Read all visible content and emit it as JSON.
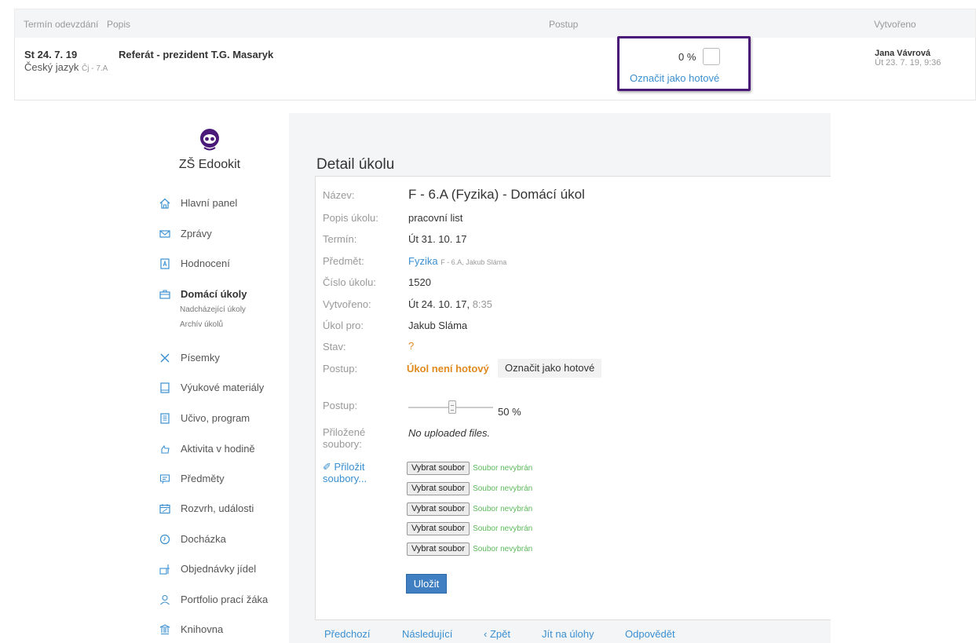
{
  "top_table": {
    "headers": {
      "due": "Termín odevzdání",
      "desc": "Popis",
      "progress": "Postup",
      "created": "Vytvořeno"
    },
    "row": {
      "date": "St 24. 7. 19",
      "subject": "Český jazyk",
      "class": "Čj - 7.A",
      "title": "Referát - prezident T.G. Masaryk",
      "progress_pct": "0 %",
      "mark_done": "Označit jako hotové",
      "author": "Jana Vávrová",
      "created": "Út 23. 7. 19, 9:36"
    }
  },
  "sidebar": {
    "school": "ZŠ Edookit",
    "items": [
      {
        "label": "Hlavní panel",
        "icon": "home-icon"
      },
      {
        "label": "Zprávy",
        "icon": "envelope-icon"
      },
      {
        "label": "Hodnocení",
        "icon": "grade-icon"
      },
      {
        "label": "Domácí úkoly",
        "icon": "briefcase-icon"
      },
      {
        "label": "Písemky",
        "icon": "pencil-ruler-icon"
      },
      {
        "label": "Výukové materiály",
        "icon": "book-icon"
      },
      {
        "label": "Učivo, program",
        "icon": "document-icon"
      },
      {
        "label": "Aktivita v hodině",
        "icon": "hand-icon"
      },
      {
        "label": "Předměty",
        "icon": "subjects-icon"
      },
      {
        "label": "Rozvrh, události",
        "icon": "calendar-icon"
      },
      {
        "label": "Docházka",
        "icon": "clock-icon"
      },
      {
        "label": "Objednávky jídel",
        "icon": "food-icon"
      },
      {
        "label": "Portfolio prací žáka",
        "icon": "person-icon"
      },
      {
        "label": "Knihovna",
        "icon": "library-icon"
      }
    ],
    "subitems": [
      "Nadcházející úkoly",
      "Archív úkolů"
    ]
  },
  "detail": {
    "heading": "Detail úkolu",
    "labels": {
      "name": "Název:",
      "description": "Popis úkolu:",
      "deadline": "Termín:",
      "subject": "Předmět:",
      "number": "Číslo úkolu:",
      "created": "Vytvořeno:",
      "for": "Úkol pro:",
      "state": "Stav:",
      "progress": "Postup:",
      "progress2": "Postup:",
      "attached_1": "Přiložené",
      "attached_2": "soubory:"
    },
    "values": {
      "name": "F - 6.A (Fyzika) - Domácí úkol",
      "description": "pracovní list",
      "deadline": "Út 31. 10. 17",
      "subject": "Fyzika",
      "subject_meta": "F - 6.A, Jakub Sláma",
      "number": "1520",
      "created_date": "Út 24. 10. 17,",
      "created_time": "8:35",
      "for": "Jakub Sláma",
      "state": "?",
      "not_done": "Úkol není hotový",
      "mark_done": "Označit jako hotové",
      "slider_value": "50 %",
      "slider_fraction": 0.5,
      "no_files": "No uploaded files."
    },
    "attach_link_1": "Přiložit",
    "attach_link_2": "soubory...",
    "file_button": "Vybrat soubor",
    "file_status": "Soubor nevybrán",
    "save": "Uložit"
  },
  "bottom_nav": {
    "prev": "Předchozí",
    "next": "Následující",
    "back": "‹ Zpět",
    "goto": "Jít na úlohy",
    "reply": "Odpovědět"
  },
  "colors": {
    "highlight_border": "#4b1a78",
    "link": "#3a8fd0",
    "warning": "#e08a1e",
    "success": "#5cb85c",
    "primary_button": "#3f7fc2"
  }
}
